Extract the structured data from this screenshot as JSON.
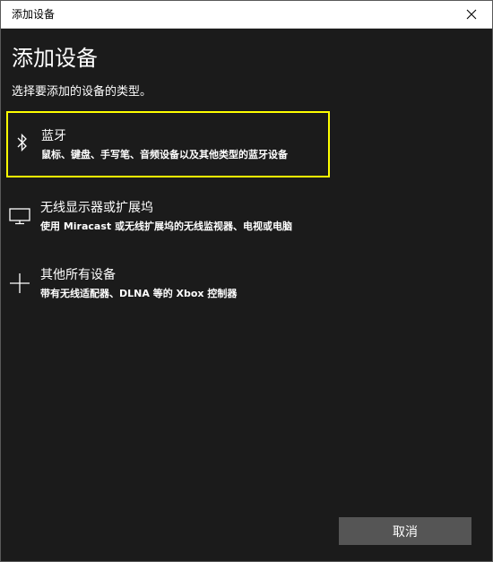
{
  "window": {
    "title": "添加设备",
    "close_icon": "close-icon"
  },
  "page": {
    "heading": "添加设备",
    "subheading": "选择要添加的设备的类型。"
  },
  "options": [
    {
      "icon": "bluetooth-icon",
      "label": "蓝牙",
      "description": "鼠标、键盘、手写笔、音频设备以及其他类型的蓝牙设备",
      "selected": true
    },
    {
      "icon": "monitor-icon",
      "label": "无线显示器或扩展坞",
      "description": "使用 Miracast 或无线扩展坞的无线监视器、电视或电脑",
      "selected": false
    },
    {
      "icon": "plus-icon",
      "label": "其他所有设备",
      "description": "带有无线适配器、DLNA 等的 Xbox 控制器",
      "selected": false
    }
  ],
  "footer": {
    "cancel_label": "取消"
  },
  "colors": {
    "background": "#1b1b1b",
    "focus_outline": "#ffff00",
    "button": "#555555",
    "titlebar": "#ffffff"
  }
}
